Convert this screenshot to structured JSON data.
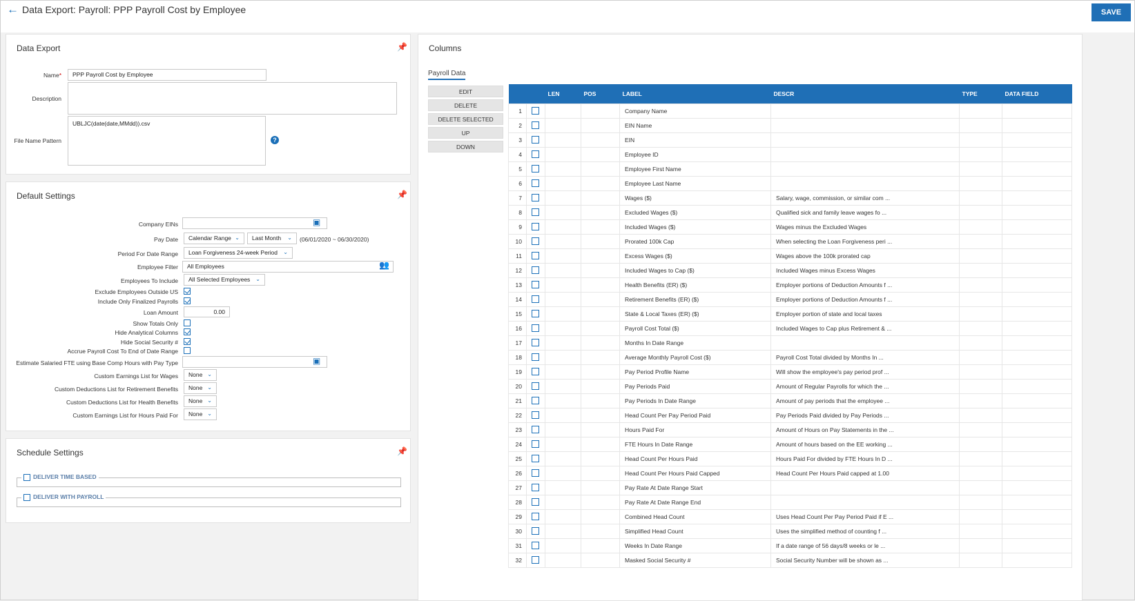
{
  "header": {
    "title": "Data Export: Payroll: PPP Payroll Cost by Employee",
    "save_label": "SAVE"
  },
  "data_export": {
    "title": "Data Export",
    "name_label": "Name",
    "name_value": "PPP Payroll Cost by Employee",
    "description_label": "Description",
    "description_value": "",
    "file_name_label": "File Name Pattern",
    "file_name_value": "UBLJC(date(date,MMdd)).csv"
  },
  "default_settings": {
    "title": "Default Settings",
    "company_eins_label": "Company EINs",
    "pay_date_label": "Pay Date",
    "pay_date_mode": "Calendar Range",
    "pay_date_range": "Last Month",
    "pay_date_text": "(06/01/2020 ~ 06/30/2020)",
    "period_label": "Period For Date Range",
    "period_value": "Loan Forgiveness 24-week Period",
    "employee_filter_label": "Employee Filter",
    "employee_filter_value": "All Employees",
    "employees_include_label": "Employees To Include",
    "employees_include_value": "All Selected Employees",
    "exclude_outside_label": "Exclude Employees Outside US",
    "exclude_outside_checked": true,
    "finalized_label": "Include Only Finalized Payrolls",
    "finalized_checked": true,
    "loan_amount_label": "Loan Amount",
    "loan_amount_value": "0.00",
    "totals_only_label": "Show Totals Only",
    "totals_only_checked": false,
    "hide_analytical_label": "Hide Analytical Columns",
    "hide_analytical_checked": true,
    "hide_ssn_label": "Hide Social Security #",
    "hide_ssn_checked": true,
    "accrue_label": "Accrue Payroll Cost To End of Date Range",
    "accrue_checked": false,
    "estimate_fte_label": "Estimate Salaried FTE using Base Comp Hours with Pay Type",
    "earnings_wages_label": "Custom Earnings List for Wages",
    "earnings_wages_value": "None",
    "deductions_retirement_label": "Custom Deductions List for Retirement Benefits",
    "deductions_retirement_value": "None",
    "deductions_health_label": "Custom Deductions List for Health Benefits",
    "deductions_health_value": "None",
    "earnings_hours_label": "Custom Earnings List for Hours Paid For",
    "earnings_hours_value": "None"
  },
  "schedule_settings": {
    "title": "Schedule Settings",
    "deliver_time_label": "DELIVER TIME BASED",
    "deliver_payroll_label": "DELIVER WITH PAYROLL"
  },
  "columns": {
    "title": "Columns",
    "tab_label": "Payroll Data",
    "actions": [
      "EDIT",
      "DELETE",
      "DELETE SELECTED",
      "UP",
      "DOWN"
    ],
    "headers": [
      "",
      "",
      "LEN",
      "POS",
      "LABEL",
      "DESCR",
      "TYPE",
      "DATA FIELD"
    ],
    "rows": [
      {
        "num": "1",
        "label": "Company Name",
        "descr": ""
      },
      {
        "num": "2",
        "label": "EIN Name",
        "descr": ""
      },
      {
        "num": "3",
        "label": "EIN",
        "descr": ""
      },
      {
        "num": "4",
        "label": "Employee ID",
        "descr": ""
      },
      {
        "num": "5",
        "label": "Employee First Name",
        "descr": ""
      },
      {
        "num": "6",
        "label": "Employee Last Name",
        "descr": ""
      },
      {
        "num": "7",
        "label": "Wages ($)",
        "descr": "Salary, wage, commission, or similar com ..."
      },
      {
        "num": "8",
        "label": "Excluded Wages ($)",
        "descr": "Qualified sick and family leave wages fo ..."
      },
      {
        "num": "9",
        "label": "Included Wages ($)",
        "descr": "Wages minus the Excluded Wages"
      },
      {
        "num": "10",
        "label": "Prorated 100k Cap",
        "descr": "When selecting the Loan Forgiveness peri ..."
      },
      {
        "num": "11",
        "label": "Excess Wages ($)",
        "descr": "Wages above the 100k prorated cap"
      },
      {
        "num": "12",
        "label": "Included Wages to Cap ($)",
        "descr": "Included Wages minus Excess Wages"
      },
      {
        "num": "13",
        "label": "Health Benefits (ER) ($)",
        "descr": "Employer portions of Deduction Amounts f ..."
      },
      {
        "num": "14",
        "label": "Retirement Benefits (ER) ($)",
        "descr": "Employer portions of Deduction Amounts f ..."
      },
      {
        "num": "15",
        "label": "State & Local Taxes (ER) ($)",
        "descr": "Employer portion of state and local taxes"
      },
      {
        "num": "16",
        "label": "Payroll Cost Total ($)",
        "descr": "Included Wages to Cap plus Retirement & ..."
      },
      {
        "num": "17",
        "label": "Months In Date Range",
        "descr": ""
      },
      {
        "num": "18",
        "label": "Average Monthly Payroll Cost ($)",
        "descr": "Payroll Cost Total divided by Months In ..."
      },
      {
        "num": "19",
        "label": "Pay Period Profile Name",
        "descr": "Will show the employee's pay period prof ..."
      },
      {
        "num": "20",
        "label": "Pay Periods Paid",
        "descr": "Amount of Regular Payrolls for which the ..."
      },
      {
        "num": "21",
        "label": "Pay Periods In Date Range",
        "descr": "Amount of pay periods that the employee ..."
      },
      {
        "num": "22",
        "label": "Head Count Per Pay Period Paid",
        "descr": "Pay Periods Paid divided by Pay Periods ..."
      },
      {
        "num": "23",
        "label": "Hours Paid For",
        "descr": "Amount of Hours on Pay Statements in the ..."
      },
      {
        "num": "24",
        "label": "FTE Hours In Date Range",
        "descr": "Amount of hours based on the EE working ..."
      },
      {
        "num": "25",
        "label": "Head Count Per Hours Paid",
        "descr": "Hours Paid For divided by FTE Hours In D ..."
      },
      {
        "num": "26",
        "label": "Head Count Per Hours Paid Capped",
        "descr": "Head Count Per Hours Paid capped at 1.00"
      },
      {
        "num": "27",
        "label": "Pay Rate At Date Range Start",
        "descr": ""
      },
      {
        "num": "28",
        "label": "Pay Rate At Date Range End",
        "descr": ""
      },
      {
        "num": "29",
        "label": "Combined Head Count",
        "descr": "Uses Head Count Per Pay Period Paid if E ..."
      },
      {
        "num": "30",
        "label": "Simplified Head Count",
        "descr": "Uses the simplified method of counting f ..."
      },
      {
        "num": "31",
        "label": "Weeks In Date Range",
        "descr": "If a date range of 56 days/8 weeks or le ..."
      },
      {
        "num": "32",
        "label": "Masked Social Security #",
        "descr": "Social Security Number will be shown as ..."
      }
    ]
  },
  "colors": {
    "accent": "#1f6fb6",
    "background": "#f2f2f2"
  }
}
